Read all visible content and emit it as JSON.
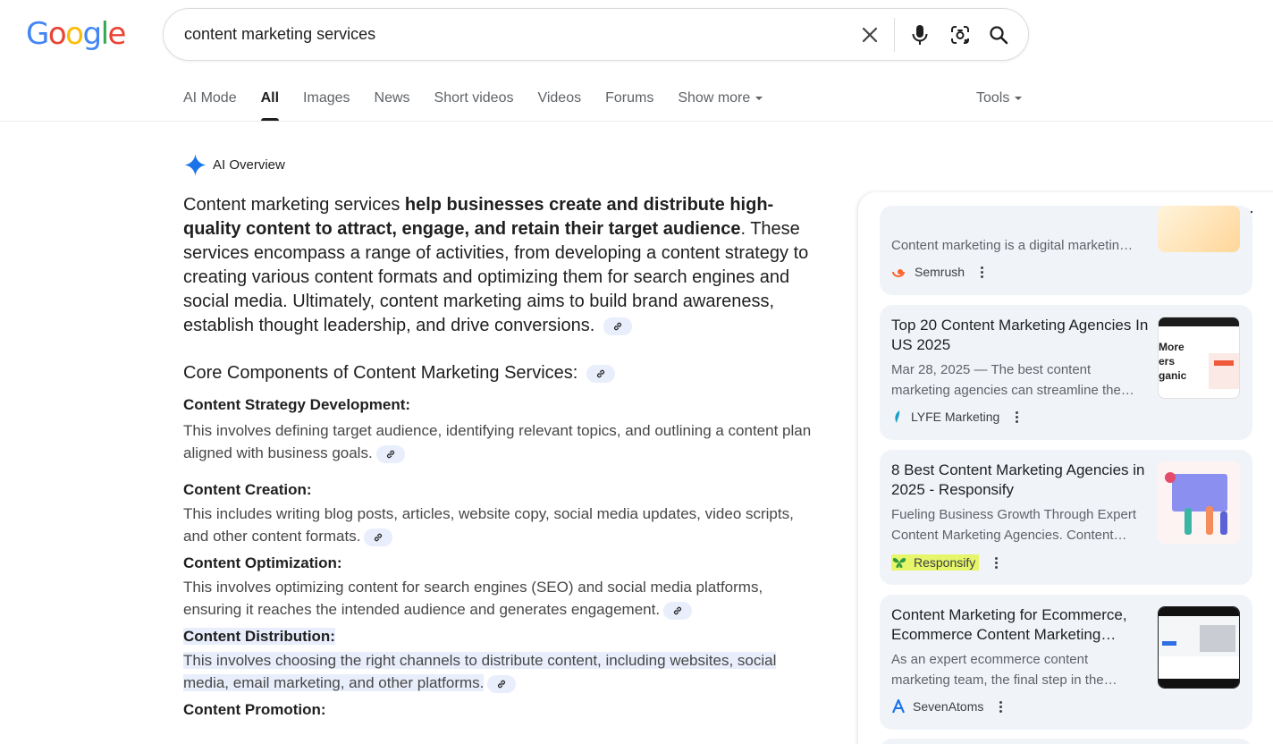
{
  "logo": "Google",
  "search": {
    "query": "content marketing services"
  },
  "tabs": [
    "AI Mode",
    "All",
    "Images",
    "News",
    "Short videos",
    "Videos",
    "Forums",
    "Show more"
  ],
  "tools_label": "Tools",
  "ai_overview": {
    "label": "AI Overview",
    "lead_start": "Content marketing services ",
    "lead_bold": "help businesses create and distribute high-quality content to attract, engage, and retain their target audience",
    "lead_end": ". These services encompass a range of activities, from developing a content strategy to creating various content formats and optimizing them for search engines and social media. Ultimately, content marketing aims to build brand awareness, establish thought leadership, and drive conversions.",
    "heading": "Core Components of Content Marketing Services:",
    "items": [
      {
        "title": "Content Strategy Development:",
        "body": "This involves defining target audience, identifying relevant topics, and outlining a content plan aligned with business goals."
      },
      {
        "title": "Content Creation:",
        "body": "This includes writing blog posts, articles, website copy, social media updates, video scripts, and other content formats."
      },
      {
        "title": "Content Optimization:",
        "body": "This involves optimizing content for search engines (SEO) and social media platforms, ensuring it reaches the intended audience and generates engagement."
      },
      {
        "title": "Content Distribution:",
        "body": "This involves choosing the right channels to distribute content, including websites, social media, email marketing, and other platforms."
      },
      {
        "title": "Content Promotion:",
        "body": ""
      }
    ]
  },
  "sources": [
    {
      "snippet": "Content marketing is a digital marketin…",
      "source": "Semrush"
    },
    {
      "title": "Top 20 Content Marketing Agencies In US 2025",
      "snippet": "Mar 28, 2025 — The best content marketing agencies can streamline the…",
      "source": "LYFE Marketing",
      "thumb_text": "More ers ganic"
    },
    {
      "title": "8 Best Content Marketing Agencies in 2025 - Responsify",
      "snippet": "Fueling Business Growth Through Expert Content Marketing Agencies. Content…",
      "source": "Responsify"
    },
    {
      "title": "Content Marketing for Ecommerce, Ecommerce Content Marketing…",
      "snippet": "As an expert ecommerce content marketing team, the final step in the…",
      "source": "SevenAtoms"
    }
  ],
  "colors": {
    "accent_blue": "#1a73e8",
    "chip_bg": "#e8eefb",
    "card_bg": "#f0f4f9",
    "responsify_highlight": "#e6f56a"
  }
}
